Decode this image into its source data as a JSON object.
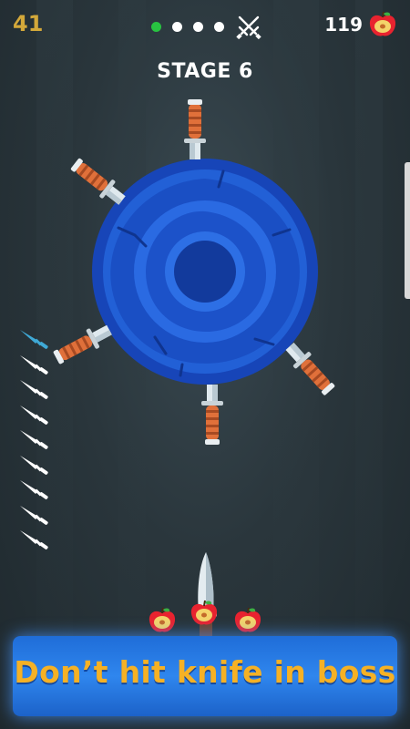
{
  "hud": {
    "score": "41",
    "apple_count": "119",
    "stage_label": "STAGE 6",
    "stage_progress": {
      "total_stages": 4,
      "current_stage_index": 1
    }
  },
  "knives_remaining": {
    "total": 9,
    "active_index": 0
  },
  "knives_in_target": 5,
  "target": {
    "type": "boss",
    "color": "#1a4fc4"
  },
  "apples_on_ground": 3,
  "banner": {
    "text": "Don’t hit knife in boss"
  },
  "colors": {
    "background": "#263238",
    "score": "#d3a83a",
    "progress_active": "#28c341",
    "banner_text": "#f5b125",
    "banner_bg": "#2f86ee"
  },
  "icons": {
    "boss_icon": "crossed-swords-icon",
    "apple_icon": "apple-icon",
    "knife_icon": "knife-icon"
  }
}
